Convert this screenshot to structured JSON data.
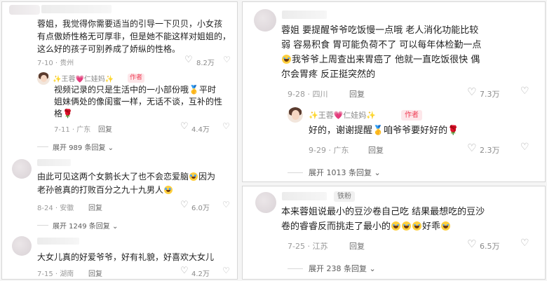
{
  "icons": {
    "heart": "heart-outline-icon",
    "dislike": "broken-heart-icon",
    "chevron": "chevron-down-icon"
  },
  "colors": {
    "author_tag_bg": "#fde7ea",
    "author_tag_text": "#ef4057",
    "fan_tag_bg": "#f0f0f0"
  },
  "left": {
    "c1": {
      "text_l1": "蓉姐，我觉得你需要适当的引导一下贝贝，小女孩",
      "text_l2": "有点傲娇性格无可厚非，但是她不能这样对姐姐的，",
      "text_l3": "这么好的孩子可别养成了娇纵的性格。",
      "date": "7-10 · 贵州",
      "likes": "8.2万"
    },
    "r1": {
      "author": "✨王蓉💗仁娃妈✨",
      "author_tag": "作者",
      "text_l1": "视频记录的只是生活中的一小部份哦🥇平时",
      "text_l2": "姐妹俩处的像闺蜜一样，无话不谈，互补的性",
      "text_l3": "格🌹",
      "date": "7-11 · 广东",
      "reply": "回复",
      "likes": "4.4万"
    },
    "expand1": "展开 989 条回复",
    "c2": {
      "text_l1": "由此可见这两个女鹅长大了也不会恋爱脑",
      "text_l1b": "因为",
      "text_l2": "老孙爸真的打败百分之九十九男人",
      "date": "8-24 · 安徽",
      "reply": "回复",
      "likes": "6.0万"
    },
    "expand2": "展开 1249 条回复",
    "c3": {
      "text_l1": "大女儿真的好爱爷爷，好有礼貌，好喜欢大女儿",
      "date": "7-15 · 湖南",
      "reply": "回复",
      "likes": "4.2万"
    }
  },
  "right_top": {
    "c1": {
      "text_l1": "蓉姐 要提醒爷爷吃饭慢一点哦 老人消化功能比较",
      "text_l2": "弱 容易积食 胃可能负荷不了 可以每年体检勤一点",
      "text_l3": "我爷爷上周查出来胃癌了 他就一直吃饭很快 偶",
      "text_l4": "尔会胃疼 反正挺突然的",
      "date": "9-28 · 四川",
      "reply": "回复",
      "likes": "7.3万"
    },
    "r1": {
      "author": "✨王蓉💗仁娃妈✨",
      "author_tag": "作者",
      "text": "好的，谢谢提醒🥇咱爷爷要好好的🌹",
      "date": "9-29 · 广东",
      "reply": "回复",
      "likes": "2.3万"
    },
    "expand": "展开 1013 条回复"
  },
  "right_bottom": {
    "c1": {
      "fan_tag": "铁粉",
      "text_l1": "本来蓉姐说最小的豆沙卷自己吃 结果最想吃的豆沙",
      "text_l2": "卷的睿睿反而挑走了最小的",
      "text_l2b": "好乖",
      "date": "7-25 · 江苏",
      "reply": "回复",
      "likes": "6.5万"
    },
    "expand": "展开 238 条回复"
  }
}
